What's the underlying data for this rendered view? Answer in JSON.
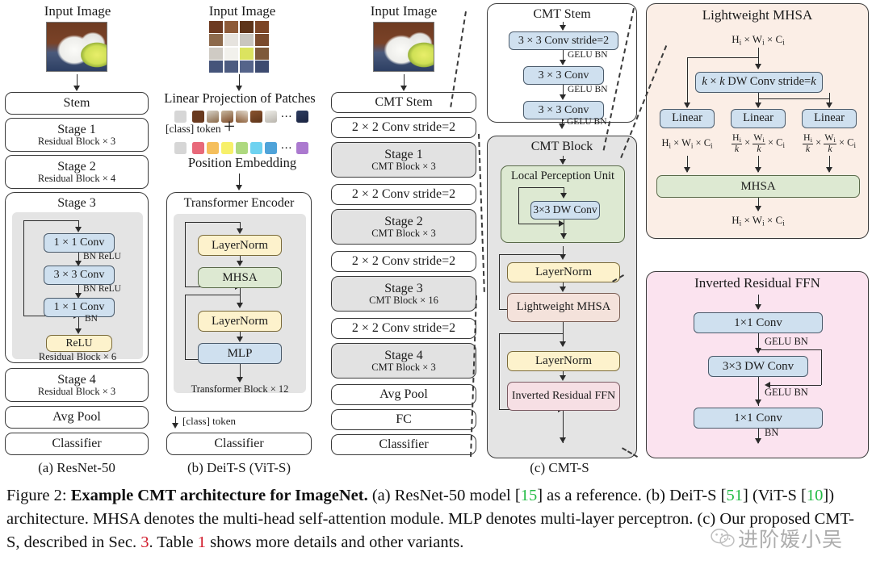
{
  "figure": {
    "caption_label": "Figure 2:",
    "caption_bold": "Example CMT architecture for ImageNet.",
    "caption_part1": " (a) ResNet-50 model [",
    "cite15": "15",
    "caption_part2": "] as a reference. (b) DeiT-S [",
    "cite51": "51",
    "caption_part3": "] (ViT-S [",
    "cite10": "10",
    "caption_part4": "]) architecture. MHSA denotes the multi-head self-attention module. MLP denotes multi-layer perceptron. (c) Our proposed CMT-S, described in Sec. ",
    "cite3": "3",
    "caption_part5": ". Table ",
    "cite1": "1",
    "caption_part6": " shows more details and other variants.",
    "watermark_text": "进阶媛小吴"
  },
  "columns": {
    "a": {
      "label": "(a) ResNet-50"
    },
    "b": {
      "label": "(b) DeiT-S (ViT-S)"
    },
    "c": {
      "label": "(c) CMT-S"
    }
  },
  "resnet": {
    "input_image_title": "Input Image",
    "stem": "Stem",
    "stage1": {
      "title": "Stage 1",
      "sub": "Residual Block × 3"
    },
    "stage2": {
      "title": "Stage 2",
      "sub": "Residual Block × 4"
    },
    "stage3": {
      "title": "Stage 3",
      "sub": "Residual Block × 6",
      "conv1": "1 × 1 Conv",
      "norm1": "BN ReLU",
      "conv2": "3 × 3 Conv",
      "norm2": "BN ReLU",
      "conv3": "1 × 1 Conv",
      "norm3": "BN",
      "relu": "ReLU"
    },
    "stage4": {
      "title": "Stage 4",
      "sub": "Residual Block × 3"
    },
    "avgpool": "Avg Pool",
    "classifier": "Classifier"
  },
  "deit": {
    "input_image_title": "Input Image",
    "linear_projection": "Linear Projection of Patches",
    "class_token": "[class] token",
    "plus": "+",
    "position_embedding": "Position Embedding",
    "ellipsis": "...",
    "encoder_title": "Transformer Encoder",
    "layernorm1": "LayerNorm",
    "mhsa": "MHSA",
    "layernorm2": "LayerNorm",
    "mlp": "MLP",
    "block_count": "Transformer Block × 12",
    "class_token_out": "[class] token",
    "classifier": "Classifier",
    "patch_colors": [
      "#d6d6d6",
      "#e8697a",
      "#f5bf5c",
      "#f7f06a",
      "#aed97f",
      "#6ed2f0",
      "#4fa3d9",
      "#ab79cf"
    ]
  },
  "cmt": {
    "input_image_title": "Input Image",
    "stem": "CMT Stem",
    "conv_stride1": "2 × 2 Conv stride=2",
    "stage1": {
      "title": "Stage 1",
      "sub": "CMT Block × 3"
    },
    "conv_stride2": "2 × 2 Conv stride=2",
    "stage2": {
      "title": "Stage 2",
      "sub": "CMT Block × 3"
    },
    "conv_stride3": "2 × 2 Conv stride=2",
    "stage3": {
      "title": "Stage 3",
      "sub": "CMT Block × 16"
    },
    "conv_stride4": "2 × 2 Conv stride=2",
    "stage4": {
      "title": "Stage 4",
      "sub": "CMT Block × 3"
    },
    "avgpool": "Avg Pool",
    "fc": "FC",
    "classifier": "Classifier"
  },
  "cmt_stem": {
    "title": "CMT Stem",
    "conv1": "3 × 3 Conv stride=2",
    "label1": "GELU BN",
    "conv2": "3 × 3 Conv",
    "label2": "GELU BN",
    "conv3": "3 × 3 Conv",
    "label3": "GELU BN"
  },
  "cmt_block": {
    "title": "CMT Block",
    "lpu_title": "Local Perception Unit",
    "lpu_conv": "3×3 DW Conv",
    "layernorm1": "LayerNorm",
    "lwmhsa": "Lightweight MHSA",
    "layernorm2": "LayerNorm",
    "irffn": "Inverted Residual FFN"
  },
  "lightweight_mhsa": {
    "title": "Lightweight MHSA",
    "dim_in": "H_i × W_i × C_i",
    "dwconv": "k × k DW Conv stride=k",
    "linear1": "Linear",
    "linear2": "Linear",
    "linear3": "Linear",
    "dim_q": "H_i × W_i × C_i",
    "dim_k": "H_i/k × W_i/k × C_i",
    "dim_v": "H_i/k × W_i/k × C_i",
    "mhsa": "MHSA",
    "dim_out": "H_i × W_i × C_i"
  },
  "inverted_residual_ffn": {
    "title": "Inverted Residual FFN",
    "conv1": "1×1 Conv",
    "label1": "GELU BN",
    "dwconv": "3×3 DW Conv",
    "label2": "GELU BN",
    "conv2": "1×1 Conv",
    "label3": "BN"
  },
  "colors": {
    "conv_blue": "#cfe0ef",
    "norm_yellow": "#fdf2cc",
    "attn_green": "#dde9d2",
    "ffn_pink": "#f6dfe4",
    "mhsa_peach": "#f4e2db",
    "stage_gray": "#e2e2e2",
    "panel_mhsa_bg": "#fbeee6",
    "panel_ffn_bg": "#fbe3ef"
  }
}
